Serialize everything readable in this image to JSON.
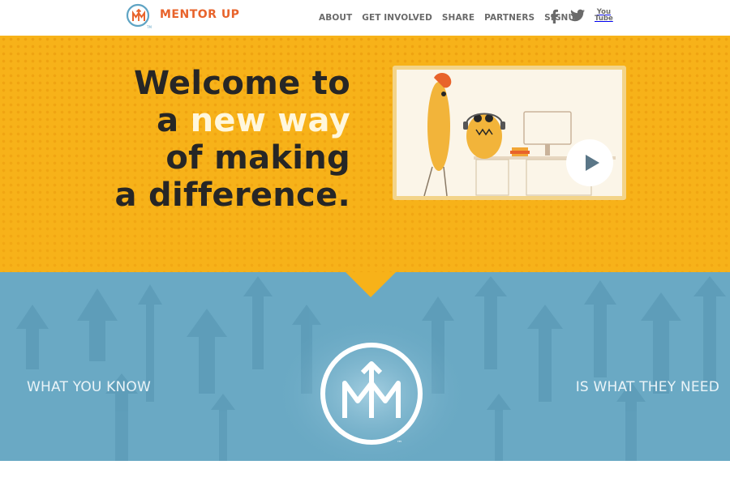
{
  "header": {
    "brand": "MENTOR UP",
    "nav": [
      "ABOUT",
      "GET INVOLVED",
      "SHARE",
      "PARTNERS",
      "SIGNUP"
    ],
    "social": {
      "facebook_icon": "facebook-icon",
      "twitter_icon": "twitter-icon",
      "youtube_label_top": "You",
      "youtube_label_bottom": "Tube"
    }
  },
  "hero": {
    "headline_line1": "Welcome to",
    "headline_line2_prefix": "a",
    "headline_line2_highlight": "new way",
    "headline_line3": "of making",
    "headline_line4": "a difference.",
    "video_play_icon": "play-icon"
  },
  "band": {
    "left_tagline": "WHAT YOU KNOW",
    "right_tagline": "IS WHAT THEY NEED",
    "emblem_tm": "™"
  },
  "colors": {
    "brand_orange": "#e8632b",
    "hero_yellow": "#f7b219",
    "band_blue": "#6aa9c4",
    "nav_gray": "#6a6a6a"
  }
}
